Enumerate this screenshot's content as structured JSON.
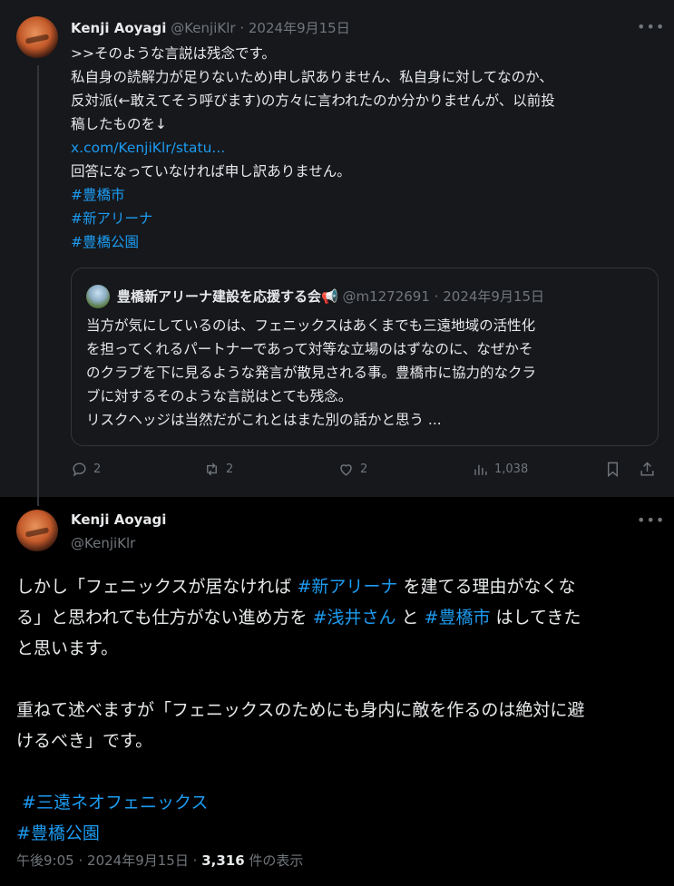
{
  "reply": {
    "author_name": "Kenji Aoyagi",
    "handle": "@KenjiKlr",
    "sep": "·",
    "date": "2024年9月15日",
    "more_icon": "•••",
    "lines": [
      ">>そのような言説は残念です。",
      "私自身の読解力が足りないため)申し訳ありません、私自身に対してなのか、",
      "反対派(←敢えてそう呼びます)の方々に言われたのか分かりませんが、以前投",
      "稿したものを↓"
    ],
    "link": "x.com/KenjiKlr/statu...",
    "line_after_link": "回答になっていなければ申し訳ありません。",
    "hashtags": [
      "#豊橋市",
      "#新アリーナ",
      "#豊橋公園"
    ]
  },
  "quote": {
    "author_name": "豊橋新アリーナ建設を応援する会📢",
    "handle": "@m1272691",
    "sep": "·",
    "date": "2024年9月15日",
    "lines": [
      "当方が気にしているのは、フェニックスはあくまでも三遠地域の活性化",
      "を担ってくれるパートナーであって対等な立場のはずなのに、なぜかそ",
      "のクラブを下に見るような発言が散見される事。豊橋市に協力的なクラ",
      "ブに対するそのような言説はとても残念。",
      "リスクヘッジは当然だがこれとはまた別の話かと思う ..."
    ]
  },
  "actions": {
    "replies": "2",
    "reposts": "2",
    "likes": "2",
    "views": "1,038"
  },
  "main": {
    "author_name": "Kenji Aoyagi",
    "handle": "@KenjiKlr",
    "more_icon": "•••",
    "p1_l1_a": "しかし「フェニックスが居なければ ",
    "p1_l1_tag": "#新アリーナ",
    "p1_l1_b": " を建てる理由がなくな",
    "p1_l2_a": "る」と思われても仕方がない進め方を ",
    "p1_l2_tag1": "#浅井さん",
    "p1_l2_mid": " と ",
    "p1_l2_tag2": "#豊橋市",
    "p1_l2_b": " はしてきた",
    "p1_l3": "と思います。",
    "p2_l1": "重ねて述べますが「フェニックスのためにも身内に敵を作るのは絶対に避",
    "p2_l2": "けるべき」です。",
    "tag_a": " #三遠ネオフェニックス",
    "tag_b": "#豊橋公園",
    "time": "午後9:05",
    "sep": "·",
    "date": "2024年9月15日",
    "views_count": "3,316",
    "views_label": " 件の表示"
  }
}
